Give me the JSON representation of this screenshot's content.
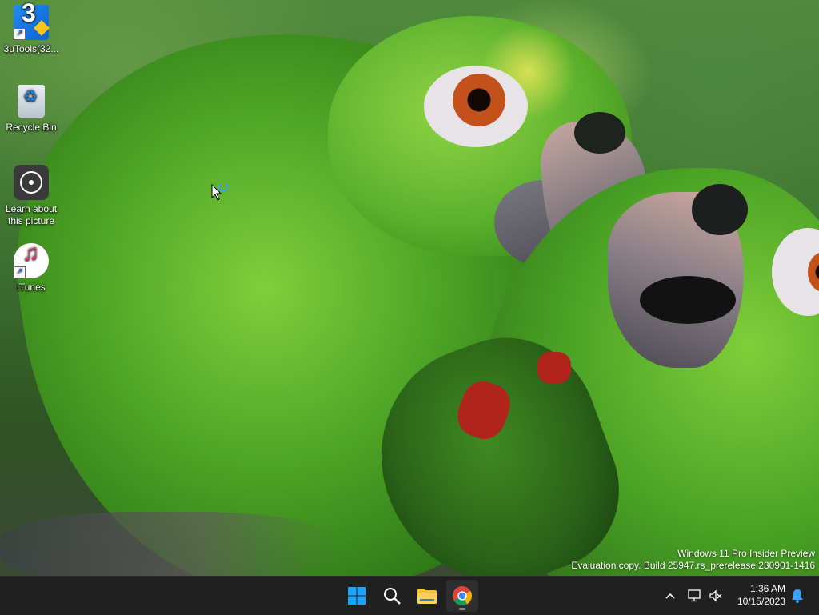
{
  "desktop": {
    "icons": [
      {
        "label": "3uTools(32...",
        "icon": "3utools-icon",
        "shortcut": true
      },
      {
        "label": "Recycle Bin",
        "icon": "recycle-bin-icon",
        "shortcut": false
      },
      {
        "label": "Learn about\nthis picture",
        "line1": "Learn about",
        "line2": "this picture",
        "icon": "learn-about-picture-icon",
        "shortcut": false
      },
      {
        "label": "iTunes",
        "icon": "itunes-icon",
        "shortcut": true
      }
    ]
  },
  "watermark": {
    "line1": "Windows 11 Pro Insider Preview",
    "line2": "Evaluation copy. Build 25947.rs_prerelease.230901-1416"
  },
  "taskbar": {
    "pinned": [
      {
        "name": "start",
        "icon": "windows-logo-icon"
      },
      {
        "name": "search",
        "icon": "search-icon"
      },
      {
        "name": "file-explorer",
        "icon": "folder-icon"
      },
      {
        "name": "chrome",
        "icon": "chrome-icon",
        "active": true
      }
    ],
    "tray": {
      "time": "1:36 AM",
      "date": "10/15/2023"
    }
  },
  "colors": {
    "taskbar_bg": "#202020",
    "accent": "#0a84ff"
  }
}
